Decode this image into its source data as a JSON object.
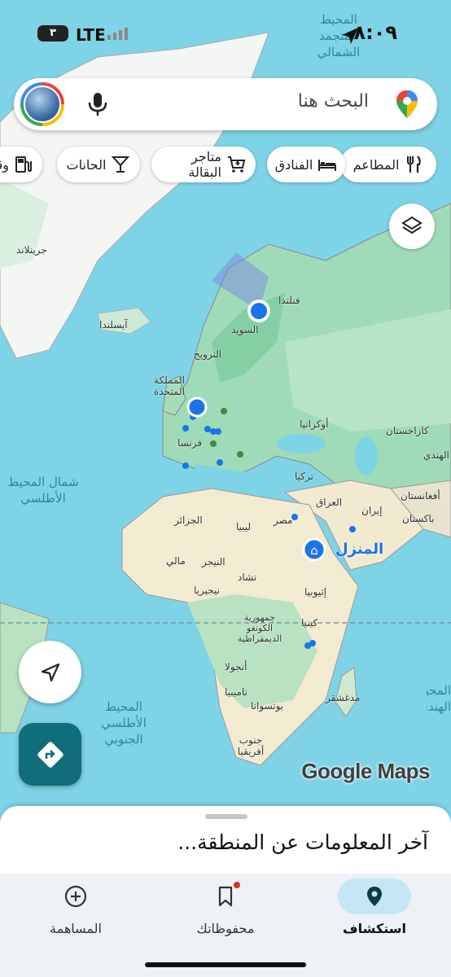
{
  "status": {
    "time": "٨:٠٩",
    "network": "LTE",
    "battery": "٣"
  },
  "search": {
    "placeholder": "البحث هنا"
  },
  "chips": [
    {
      "label": "المطاعم",
      "icon": "restaurant-icon"
    },
    {
      "label": "الفنادق",
      "icon": "hotel-icon"
    },
    {
      "label": "متاجر البقالة",
      "icon": "cart-icon"
    },
    {
      "label": "الحانات",
      "icon": "bar-icon"
    },
    {
      "label": "وقـ",
      "icon": "gas-station-icon"
    }
  ],
  "map": {
    "labels": {
      "greenland": "جرينلاند",
      "iceland": "آيسلندا",
      "finland": "فنلندا",
      "sweden": "السويد",
      "norway": "النرويج",
      "uk": "المملكة المتحدة",
      "france": "فرنسا",
      "ukraine": "أوكرانيا",
      "kazakhstan": "كازاخستان",
      "turkey": "تركيا",
      "iraq": "العراق",
      "iran": "إيران",
      "afghanistan": "أفغانستان",
      "pakistan": "باكستان",
      "algeria": "الجزائر",
      "libya": "ليبيا",
      "egypt": "مصر",
      "mali": "مالي",
      "niger": "النيجر",
      "chad": "تشاد",
      "nigeria": "نيجيريا",
      "ethiopia": "إثيوبيا",
      "drc": "جمهورية الكونغو الديمقراطية",
      "kenya": "كينيا",
      "angola": "أنجولا",
      "namibia": "ناميبيا",
      "botswana": "بوتسوانا",
      "south_africa": "جنوب أفريقيا",
      "madagascar": "مدغشقر",
      "india": "الهندي",
      "home": "المنزل"
    },
    "seas": {
      "arctic": "المحيط المتجمد الشمالي",
      "north_atlantic": "شمال المحيط الأطلسي",
      "south_atlantic": "المحيط الأطلسي الجنوبي",
      "indian": "المحيط الهندي"
    },
    "logo": "Google Maps"
  },
  "sheet": {
    "title": "آخر المعلومات عن المنطقة..."
  },
  "nav": [
    {
      "label": "استكشاف",
      "icon": "location-pin-icon",
      "active": true
    },
    {
      "label": "محفوظاتك",
      "icon": "bookmark-icon",
      "active": false
    },
    {
      "label": "المساهمة",
      "icon": "add-circle-icon",
      "active": false
    }
  ],
  "colors": {
    "sea": "#7fd3e6",
    "land": "#eef0e6",
    "forest": "#b7e3c5",
    "desert": "#f3ead2",
    "accent": "#1a73e8",
    "nav_active": "#c5e6f5"
  }
}
